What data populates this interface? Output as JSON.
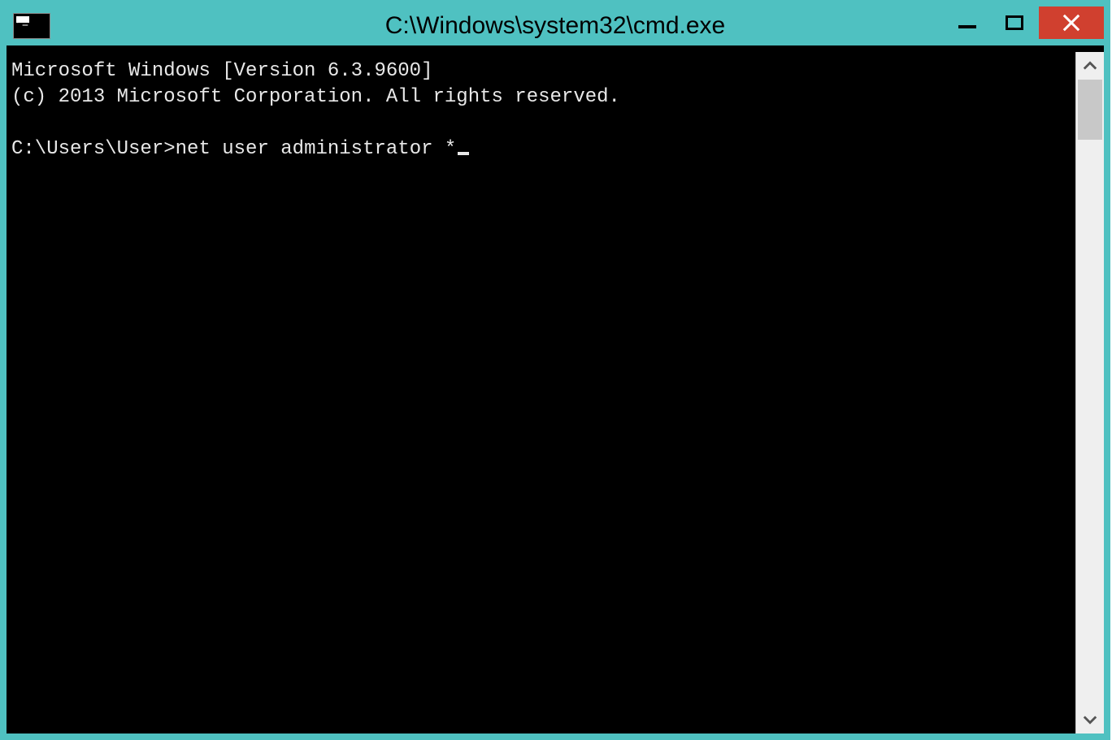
{
  "window": {
    "title": "C:\\Windows\\system32\\cmd.exe"
  },
  "terminal": {
    "line1": "Microsoft Windows [Version 6.3.9600]",
    "line2": "(c) 2013 Microsoft Corporation. All rights reserved.",
    "blank": "",
    "prompt": "C:\\Users\\User>",
    "command": "net user administrator *"
  }
}
